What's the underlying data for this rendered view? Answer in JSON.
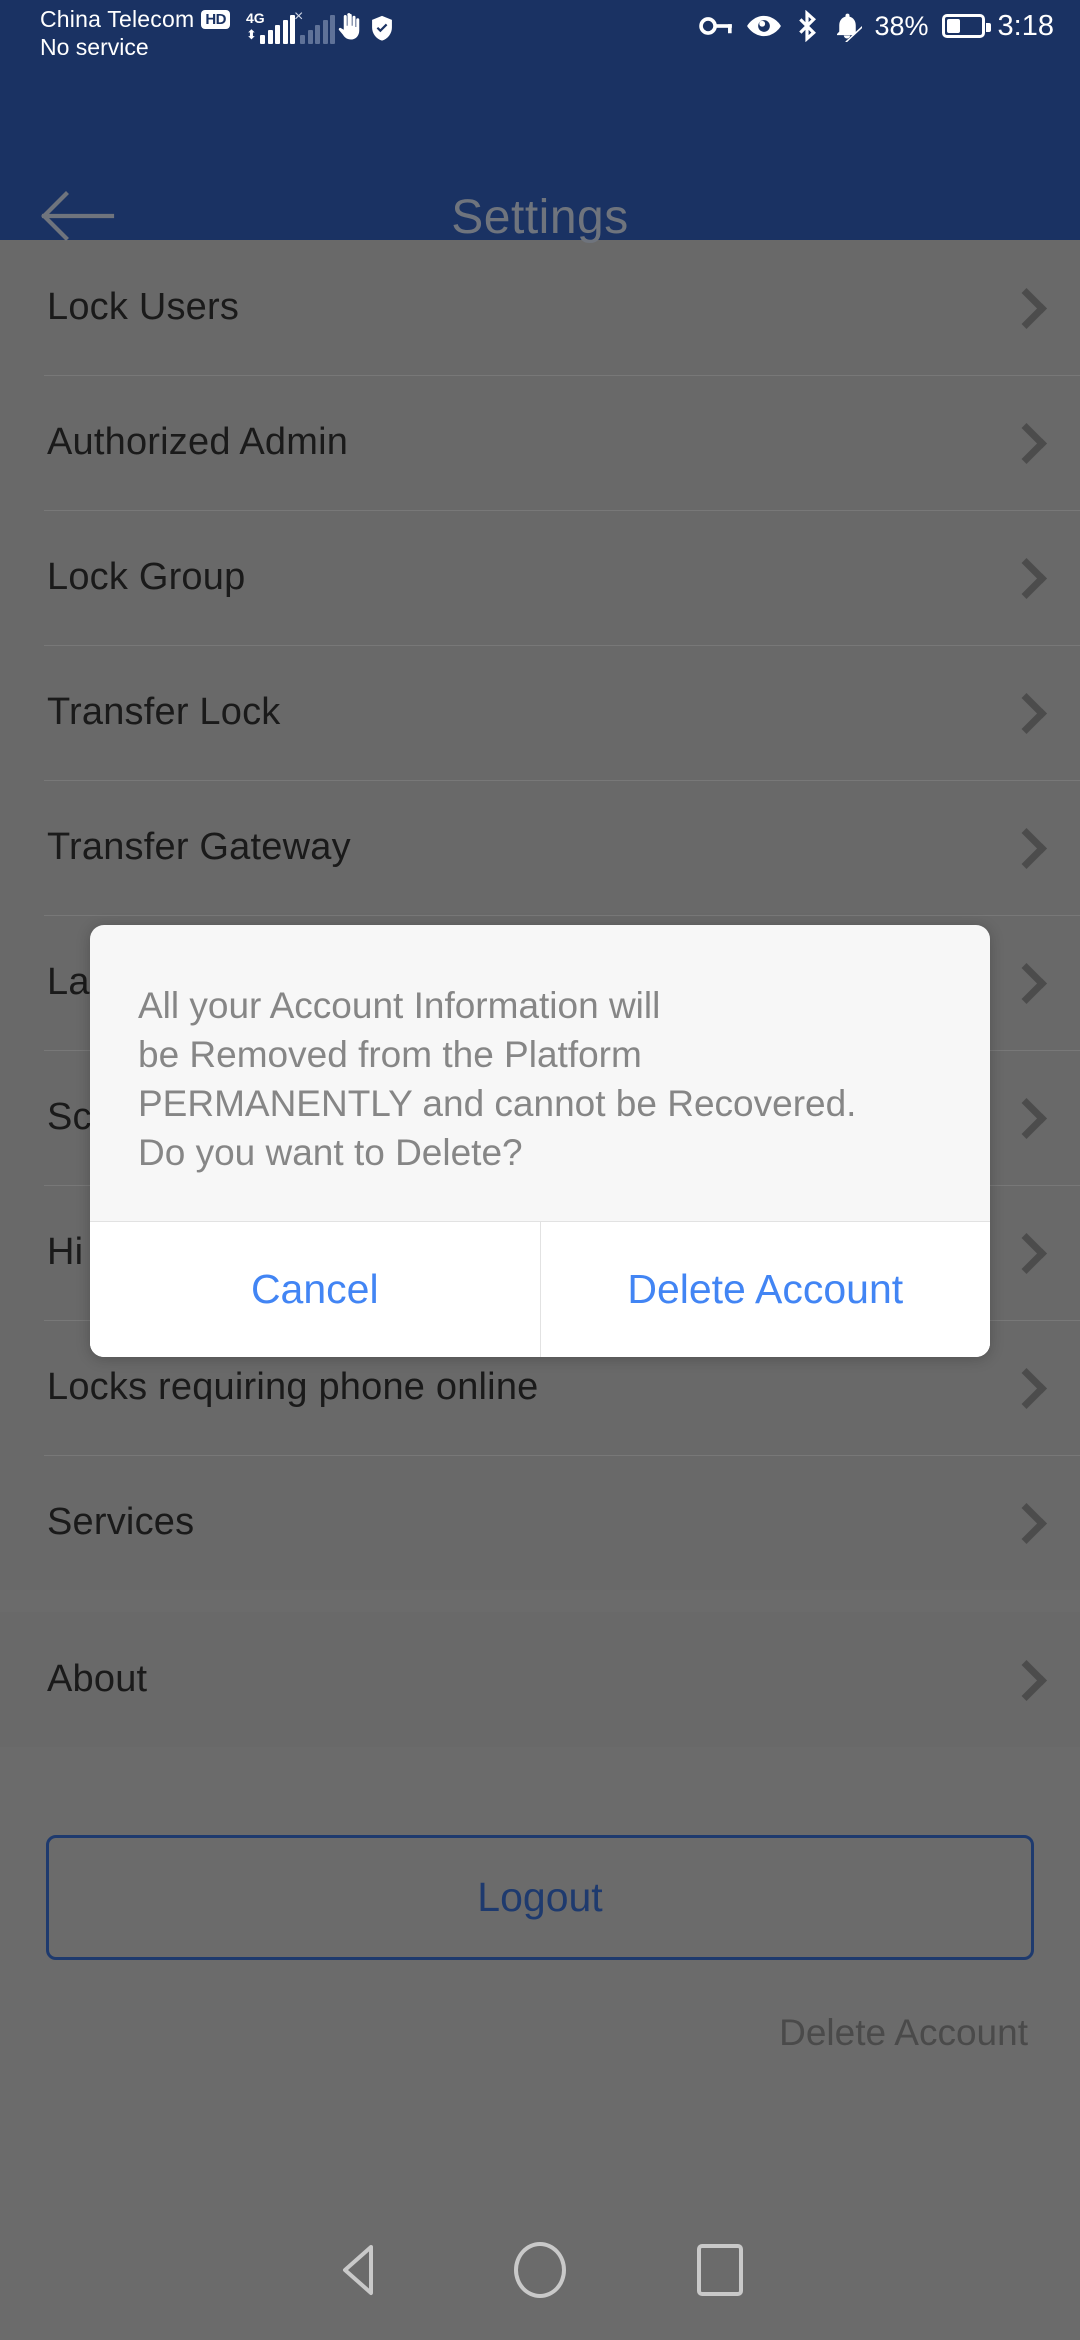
{
  "status_bar": {
    "carrier": "China Telecom",
    "hd_badge": "HD",
    "no_service": "No service",
    "network_generation": "4G",
    "battery_percent": "38%",
    "time": "3:18",
    "icons": [
      "vpn-key-icon",
      "eye-icon",
      "bluetooth-icon",
      "bell-off-icon",
      "battery-icon"
    ],
    "left_icons": [
      "signal-bars-icon",
      "signal-bars-inactive-icon",
      "hand-icon",
      "shield-check-icon"
    ],
    "colors": {
      "background": "#1a3263",
      "foreground": "#ffffff"
    }
  },
  "app_bar": {
    "title": "Settings",
    "back_icon": "back-arrow-icon",
    "colors": {
      "background": "#1a3263",
      "title": "#6f747d"
    }
  },
  "settings_list": {
    "section_one": [
      {
        "label": "Lock Users",
        "chevron": "chevron-right-icon"
      },
      {
        "label": "Authorized Admin",
        "chevron": "chevron-right-icon"
      },
      {
        "label": "Lock Group",
        "chevron": "chevron-right-icon"
      },
      {
        "label": "Transfer Lock",
        "chevron": "chevron-right-icon"
      },
      {
        "label": "Transfer Gateway",
        "chevron": "chevron-right-icon"
      },
      {
        "label": "La",
        "chevron": "chevron-right-icon"
      },
      {
        "label": "Sc",
        "chevron": "chevron-right-icon"
      },
      {
        "label": "Hi",
        "chevron": "chevron-right-icon"
      },
      {
        "label": "Locks requiring phone online",
        "chevron": "chevron-right-icon"
      },
      {
        "label": "Services",
        "chevron": "chevron-right-icon"
      }
    ],
    "section_two": [
      {
        "label": "About",
        "chevron": "chevron-right-icon"
      }
    ]
  },
  "footer": {
    "logout_label": "Logout",
    "delete_account_label": "Delete Account",
    "logout_color": "#1e3a6e"
  },
  "dialog": {
    "message": "All your Account Information will\nbe Removed from the Platform\nPERMANENTLY and cannot be Recovered.\nDo you want to Delete?",
    "cancel_label": "Cancel",
    "confirm_label": "Delete Account",
    "action_color": "#4285f4"
  },
  "nav_bar": {
    "back_icon": "nav-back-triangle-icon",
    "home_icon": "nav-home-circle-icon",
    "recents_icon": "nav-recents-square-icon"
  }
}
